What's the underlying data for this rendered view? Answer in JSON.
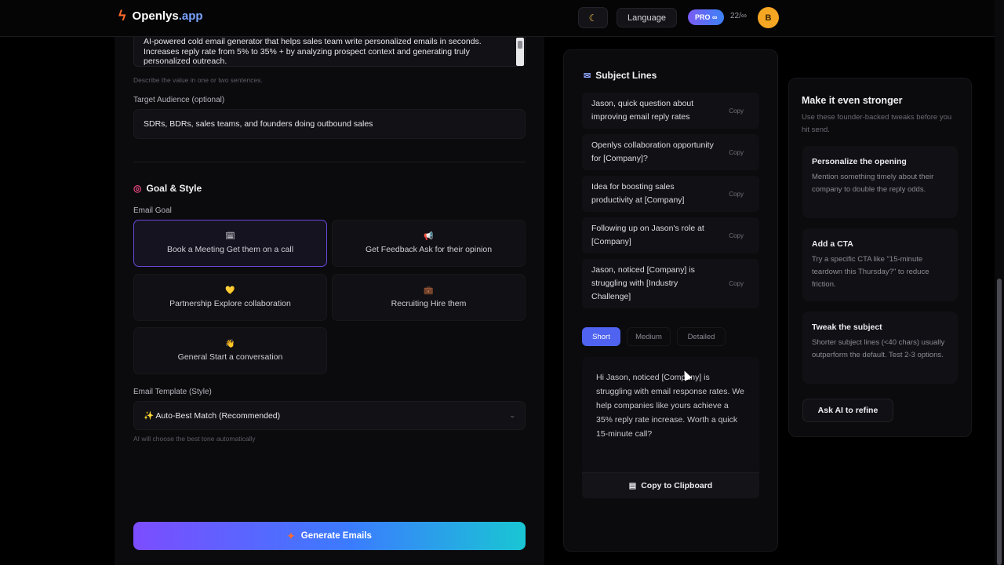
{
  "header": {
    "logo_name": "Openlys",
    "logo_tld": ".app",
    "theme_icon": "moon-icon",
    "language_label": "Language",
    "pro_badge": "PRO ∞",
    "credits": "22/∞",
    "avatar_initial": "B"
  },
  "form": {
    "value_prop_text": "AI-powered cold email generator that helps sales team write personalized emails in seconds. Increases reply rate from 5% to 35% + by analyzing prospect context and generating truly personalized outreach.",
    "value_prop_hint": "Describe the value in one or two sentences.",
    "audience_label": "Target Audience (optional)",
    "audience_value": "SDRs, BDRs, sales teams, and founders doing outbound sales",
    "goal_section_title": "Goal & Style",
    "goal_section_icon": "target-icon",
    "email_goal_label": "Email Goal",
    "goals": [
      {
        "icon": "🗓",
        "label": "Book a Meeting Get them on a call",
        "selected": true
      },
      {
        "icon": "📢",
        "label": "Get Feedback Ask for their opinion",
        "selected": false
      },
      {
        "icon": "💛",
        "label": "Partnership Explore collaboration",
        "selected": false
      },
      {
        "icon": "💼",
        "label": "Recruiting Hire them",
        "selected": false
      },
      {
        "icon": "👋",
        "label": "General Start a conversation",
        "selected": false
      }
    ],
    "template_label": "Email Template (Style)",
    "template_value": "✨ Auto-Best Match (Recommended)",
    "template_hint": "AI will choose the best tone automatically",
    "generate_label": "Generate Emails"
  },
  "results": {
    "subject_title": "Subject Lines",
    "subject_icon": "envelope-icon",
    "copy_label": "Copy",
    "subject_lines": [
      "Jason, quick question about improving email reply rates",
      "Openlys collaboration opportunity for [Company]?",
      "Idea for boosting sales productivity at [Company]",
      "Following up on Jason's role at [Company]",
      "Jason, noticed [Company] is struggling with [Industry Challenge]"
    ],
    "tabs": [
      "Short",
      "Medium",
      "Detailed"
    ],
    "active_tab": "Short",
    "email_body": "Hi Jason, noticed [Company] is struggling with email response rates. We help companies like yours achieve a 35% reply rate increase. Worth a quick 15-minute call?",
    "copy_clipboard_label": "Copy to Clipboard"
  },
  "tips": {
    "title": "Make it even stronger",
    "subtitle": "Use these founder-backed tweaks before you hit send.",
    "items": [
      {
        "title": "Personalize the opening",
        "body": "Mention something timely about their company to double the reply odds."
      },
      {
        "title": "Add a CTA",
        "body": "Try a specific CTA like \"15-minute teardown this Thursday?\" to reduce friction."
      },
      {
        "title": "Tweak the subject",
        "body": "Shorter subject lines (<40 chars) usually outperform the default. Test 2-3 options."
      }
    ],
    "ask_ai_label": "Ask AI to refine"
  },
  "colors": {
    "accent_purple": "#7c4dff",
    "accent_blue": "#4f63f0",
    "accent_cyan": "#19c6d3",
    "avatar": "#f5a623"
  }
}
